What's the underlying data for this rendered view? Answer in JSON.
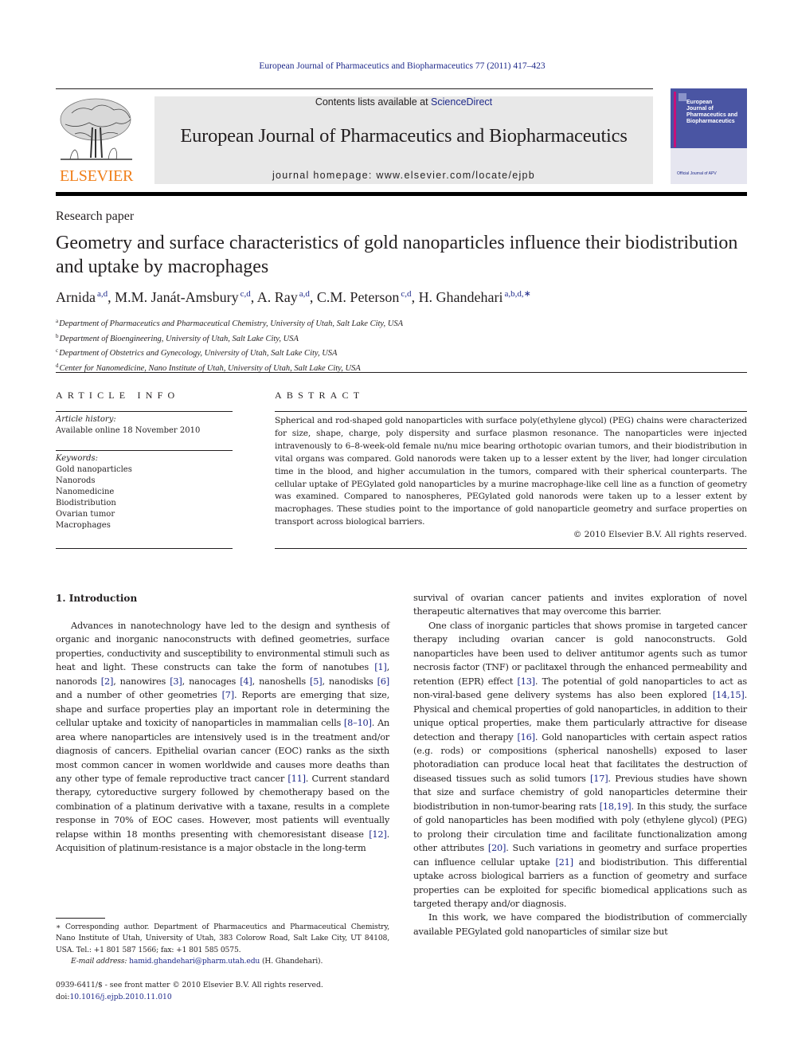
{
  "running_head": "European Journal of Pharmaceutics and Biopharmaceutics 77 (2011) 417–423",
  "header": {
    "publisher_logo_text": "ELSEVIER",
    "contents_prefix": "Contents lists available at ",
    "contents_link": "ScienceDirect",
    "journal_title": "European Journal of Pharmaceutics and Biopharmaceutics",
    "homepage_prefix": "journal homepage: ",
    "homepage_url": "www.elsevier.com/locate/ejpb",
    "cover_title_lines": [
      "European",
      "Journal of",
      "Pharmaceutics and",
      "Biopharmaceutics"
    ],
    "cover_footer": "Official Journal of APV"
  },
  "article": {
    "type": "Research paper",
    "title": "Geometry and surface characteristics of gold nanoparticles influence their biodistribution and uptake by macrophages",
    "authors": [
      {
        "name": "Arnida",
        "affil": "a,d",
        "sep": ", "
      },
      {
        "name": "M.M. Janát-Amsbury",
        "affil": "c,d",
        "sep": ", "
      },
      {
        "name": "A. Ray",
        "affil": "a,d",
        "sep": ", "
      },
      {
        "name": "C.M. Peterson",
        "affil": "c,d",
        "sep": ", "
      },
      {
        "name": "H. Ghandehari",
        "affil": "a,b,d,∗",
        "sep": ""
      }
    ],
    "affiliations": [
      {
        "key": "a",
        "text": "Department of Pharmaceutics and Pharmaceutical Chemistry, University of Utah, Salt Lake City, USA"
      },
      {
        "key": "b",
        "text": "Department of Bioengineering, University of Utah, Salt Lake City, USA"
      },
      {
        "key": "c",
        "text": "Department of Obstetrics and Gynecology, University of Utah, Salt Lake City, USA"
      },
      {
        "key": "d",
        "text": "Center for Nanomedicine, Nano Institute of Utah, University of Utah, Salt Lake City, USA"
      }
    ]
  },
  "article_info": {
    "heading": "ARTICLE INFO",
    "history_label": "Article history:",
    "history_value": "Available online 18 November 2010",
    "keywords_label": "Keywords:",
    "keywords": [
      "Gold nanoparticles",
      "Nanorods",
      "Nanomedicine",
      "Biodistribution",
      "Ovarian tumor",
      "Macrophages"
    ]
  },
  "abstract": {
    "heading": "ABSTRACT",
    "text": "Spherical and rod-shaped gold nanoparticles with surface poly(ethylene glycol) (PEG) chains were characterized for size, shape, charge, poly dispersity and surface plasmon resonance. The nanoparticles were injected intravenously to 6–8-week-old female nu/nu mice bearing orthotopic ovarian tumors, and their biodistribution in vital organs was compared. Gold nanorods were taken up to a lesser extent by the liver, had longer circulation time in the blood, and higher accumulation in the tumors, compared with their spherical counterparts. The cellular uptake of PEGylated gold nanoparticles by a murine macrophage-like cell line as a function of geometry was examined. Compared to nanospheres, PEGylated gold nanorods were taken up to a lesser extent by macrophages. These studies point to the importance of gold nanoparticle geometry and surface properties on transport across biological barriers.",
    "copyright": "© 2010 Elsevier B.V. All rights reserved."
  },
  "introduction": {
    "heading": "1. Introduction",
    "left_paragraphs": [
      [
        {
          "t": "Advances in nanotechnology have led to the design and synthesis of organic and inorganic nanoconstructs with defined geometries, surface properties, conductivity and susceptibility to environmental stimuli such as heat and light. These constructs can take the form of nanotubes "
        },
        {
          "ref": "[1]"
        },
        {
          "t": ", nanorods "
        },
        {
          "ref": "[2]"
        },
        {
          "t": ", nanowires "
        },
        {
          "ref": "[3]"
        },
        {
          "t": ", nanocages "
        },
        {
          "ref": "[4]"
        },
        {
          "t": ", nanoshells "
        },
        {
          "ref": "[5]"
        },
        {
          "t": ", nanodisks "
        },
        {
          "ref": "[6]"
        },
        {
          "t": " and a number of other geometries "
        },
        {
          "ref": "[7]"
        },
        {
          "t": ". Reports are emerging that size, shape and surface properties play an important role in determining the cellular uptake and toxicity of nanoparticles in mammalian cells "
        },
        {
          "ref": "[8–10]"
        },
        {
          "t": ". An area where nanoparticles are intensively used is in the treatment and/or diagnosis of cancers. Epithelial ovarian cancer (EOC) ranks as the sixth most common cancer in women worldwide and causes more deaths than any other type of female reproductive tract cancer "
        },
        {
          "ref": "[11]"
        },
        {
          "t": ". Current standard therapy, cytoreductive surgery followed by chemotherapy based on the combination of a platinum derivative with a taxane, results in a complete response in 70% of EOC cases. However, most patients will eventually relapse within 18 months presenting with chemoresistant disease "
        },
        {
          "ref": "[12]"
        },
        {
          "t": ". Acquisition of platinum-resistance is a major obstacle in the long-term"
        }
      ]
    ],
    "right_paragraphs": [
      [
        {
          "t": "survival of ovarian cancer patients and invites exploration of novel therapeutic alternatives that may overcome this barrier."
        }
      ],
      [
        {
          "t": "One class of inorganic particles that shows promise in targeted cancer therapy including ovarian cancer is gold nanoconstructs. Gold nanoparticles have been used to deliver antitumor agents such as tumor necrosis factor (TNF) or paclitaxel through the enhanced permeability and retention (EPR) effect "
        },
        {
          "ref": "[13]"
        },
        {
          "t": ". The potential of gold nanoparticles to act as non-viral-based gene delivery systems has also been explored "
        },
        {
          "ref": "[14,15]"
        },
        {
          "t": ". Physical and chemical properties of gold nanoparticles, in addition to their unique optical properties, make them particularly attractive for disease detection and therapy "
        },
        {
          "ref": "[16]"
        },
        {
          "t": ". Gold nanoparticles with certain aspect ratios (e.g. rods) or compositions (spherical nanoshells) exposed to laser photoradiation can produce local heat that facilitates the destruction of diseased tissues such as solid tumors "
        },
        {
          "ref": "[17]"
        },
        {
          "t": ". Previous studies have shown that size and surface chemistry of gold nanoparticles determine their biodistribution in non-tumor-bearing rats "
        },
        {
          "ref": "[18,19]"
        },
        {
          "t": ". In this study, the surface of gold nanoparticles has been modified with poly (ethylene glycol) (PEG) to prolong their circulation time and facilitate functionalization among other attributes "
        },
        {
          "ref": "[20]"
        },
        {
          "t": ". Such variations in geometry and surface properties can influence cellular uptake "
        },
        {
          "ref": "[21]"
        },
        {
          "t": " and biodistribution. This differential uptake across biological barriers as a function of geometry and surface properties can be exploited for specific biomedical applications such as targeted therapy and/or diagnosis."
        }
      ],
      [
        {
          "t": "In this work, we have compared the biodistribution of commercially available PEGylated gold nanoparticles of similar size but"
        }
      ]
    ]
  },
  "footnote": {
    "corresponding": "∗ Corresponding author. Department of Pharmaceutics and Pharmaceutical Chemistry, Nano Institute of Utah, University of Utah, 383 Colorow Road, Salt Lake City, UT 84108, USA. Tel.: +1 801 587 1566; fax: +1 801 585 0575.",
    "email_label": "E-mail address:",
    "email": "hamid.ghandehari@pharm.utah.edu",
    "email_suffix": " (H. Ghandehari).",
    "issn": "0939-6411/$ - see front matter © 2010 Elsevier B.V. All rights reserved.",
    "doi_prefix": "doi:",
    "doi": "10.1016/j.ejpb.2010.11.010"
  },
  "colors": {
    "link_blue": "#1f2a8a",
    "elsevier_orange": "#f07f1a",
    "banner_gray": "#e8e8e8",
    "cover_blue": "#4a55a3",
    "cover_magenta": "#c7117a"
  }
}
